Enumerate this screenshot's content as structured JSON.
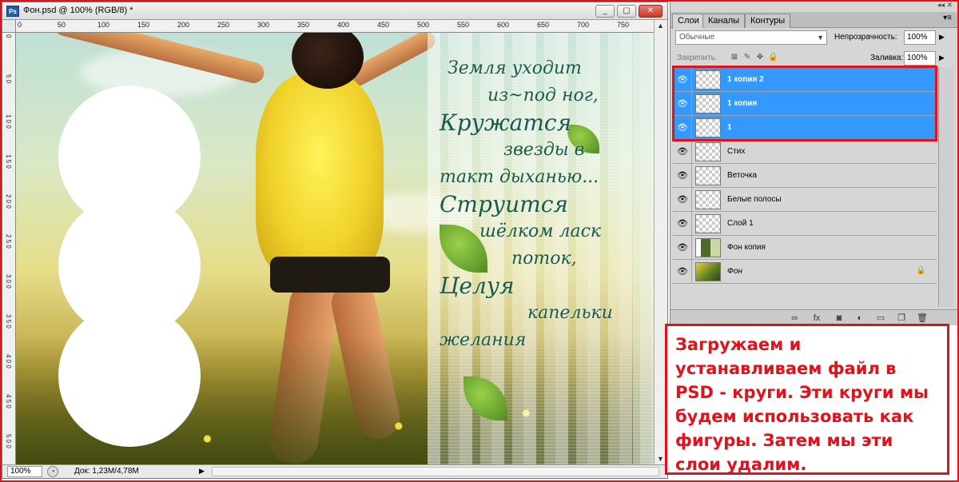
{
  "document": {
    "title": "Фон.psd @ 100% (RGB/8) *",
    "app_badge": "Ps",
    "ruler_top_labels": [
      "0",
      "50",
      "100",
      "150",
      "200",
      "250",
      "300",
      "350",
      "400",
      "450",
      "500",
      "550",
      "600",
      "650",
      "700",
      "750"
    ],
    "ruler_left_labels": [
      "0",
      "5 0",
      "1 0 0",
      "1 5 0",
      "2 0 0",
      "2 5 0",
      "3 0 0",
      "3 5 0",
      "4 0 0",
      "4 5 0",
      "5 0 0"
    ],
    "poem_lines": [
      "Земля уходит",
      "из~под ног,",
      "Кружатся",
      "звезды в",
      "такт дыханью...",
      "Струится",
      "шёлком ласк",
      "поток,",
      "Целуя",
      "капельки",
      "желания"
    ],
    "window_buttons": {
      "minimize": "_",
      "restore": "▢",
      "close": "✕"
    }
  },
  "statusbar": {
    "zoom": "100%",
    "doc_info": "Док: 1,23M/4,78M"
  },
  "layers_panel": {
    "tabs": [
      {
        "label": "Слои",
        "active": true
      },
      {
        "label": "Каналы",
        "active": false
      },
      {
        "label": "Контуры",
        "active": false
      }
    ],
    "blend_mode": "Обычные",
    "opacity_label": "Непрозрачность:",
    "opacity_value": "100%",
    "lock_label": "Закрепить:",
    "fill_label": "Заливка:",
    "fill_value": "100%",
    "layers": [
      {
        "name": "1 копия 2",
        "selected": true,
        "thumb": "transparent"
      },
      {
        "name": "1 копия",
        "selected": true,
        "thumb": "transparent"
      },
      {
        "name": "1",
        "selected": true,
        "thumb": "transparent"
      },
      {
        "name": "Стих",
        "selected": false,
        "thumb": "transparent"
      },
      {
        "name": "Веточка",
        "selected": false,
        "thumb": "transparent"
      },
      {
        "name": "Белые полосы",
        "selected": false,
        "thumb": "transparent"
      },
      {
        "name": "Слой 1",
        "selected": false,
        "thumb": "transparent"
      },
      {
        "name": "Фон копия",
        "selected": false,
        "thumb": "photo2"
      },
      {
        "name": "Фон",
        "selected": false,
        "thumb": "photo",
        "locked": true,
        "italic": true
      }
    ]
  },
  "annotation": {
    "text": "Загружаем и устанавливаем файл в PSD - круги. Эти круги мы будем использовать как фигуры. Затем мы эти слои удалим."
  },
  "colors": {
    "annotation_red": "#e0121b",
    "selection_blue": "#3399ff"
  }
}
